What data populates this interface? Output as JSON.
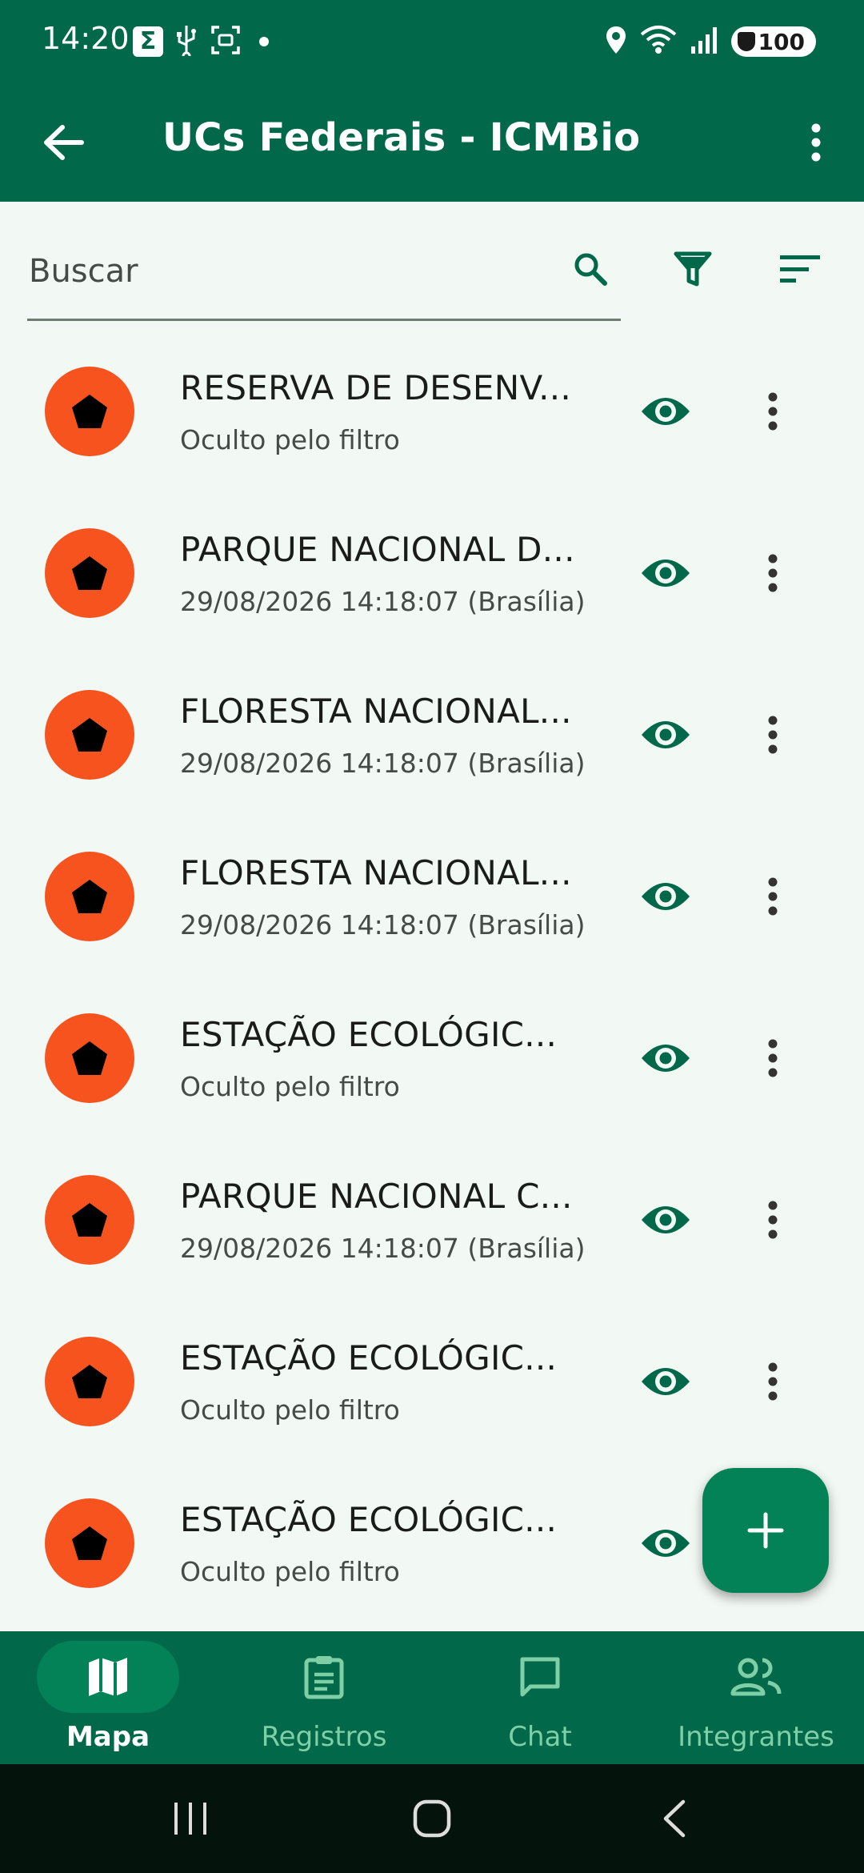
{
  "status_bar": {
    "time": "14:20",
    "battery": "100",
    "left_icons": [
      "sigma-icon",
      "usb-icon",
      "screenshot-icon",
      "dot-icon"
    ],
    "right_icons": [
      "location-icon",
      "wifi-icon",
      "signal-icon",
      "battery-icon"
    ]
  },
  "app_bar": {
    "title": "UCs Federais - ICMBio",
    "back_icon": "arrow-left-icon",
    "more_icon": "more-vert-icon"
  },
  "search": {
    "placeholder": "Buscar",
    "value": ""
  },
  "list": {
    "items": [
      {
        "title": "RESERVA DE DESENV...",
        "subtitle": "Oculto pelo filtro"
      },
      {
        "title": "PARQUE NACIONAL D...",
        "subtitle": "29/08/2026 14:18:07 (Brasília)"
      },
      {
        "title": "FLORESTA NACIONAL...",
        "subtitle": "29/08/2026 14:18:07 (Brasília)"
      },
      {
        "title": "FLORESTA NACIONAL...",
        "subtitle": "29/08/2026 14:18:07 (Brasília)"
      },
      {
        "title": "ESTAÇÃO ECOLÓGIC...",
        "subtitle": "Oculto pelo filtro"
      },
      {
        "title": "PARQUE NACIONAL C...",
        "subtitle": "29/08/2026 14:18:07 (Brasília)"
      },
      {
        "title": "ESTAÇÃO ECOLÓGIC...",
        "subtitle": "Oculto pelo filtro"
      },
      {
        "title": "ESTAÇÃO ECOLÓGIC...",
        "subtitle": "Oculto pelo filtro"
      }
    ]
  },
  "fab": {
    "icon": "plus-icon"
  },
  "bottom_nav": {
    "items": [
      {
        "label": "Mapa",
        "icon": "map-icon",
        "active": true
      },
      {
        "label": "Registros",
        "icon": "clipboard-icon",
        "active": false
      },
      {
        "label": "Chat",
        "icon": "chat-icon",
        "active": false
      },
      {
        "label": "Integrantes",
        "icon": "people-icon",
        "active": false
      }
    ]
  },
  "colors": {
    "primary": "#01684a",
    "fab": "#038258",
    "avatar": "#f6531f",
    "background": "#f2f8f3",
    "nav_inactive": "#7fcfa6"
  }
}
